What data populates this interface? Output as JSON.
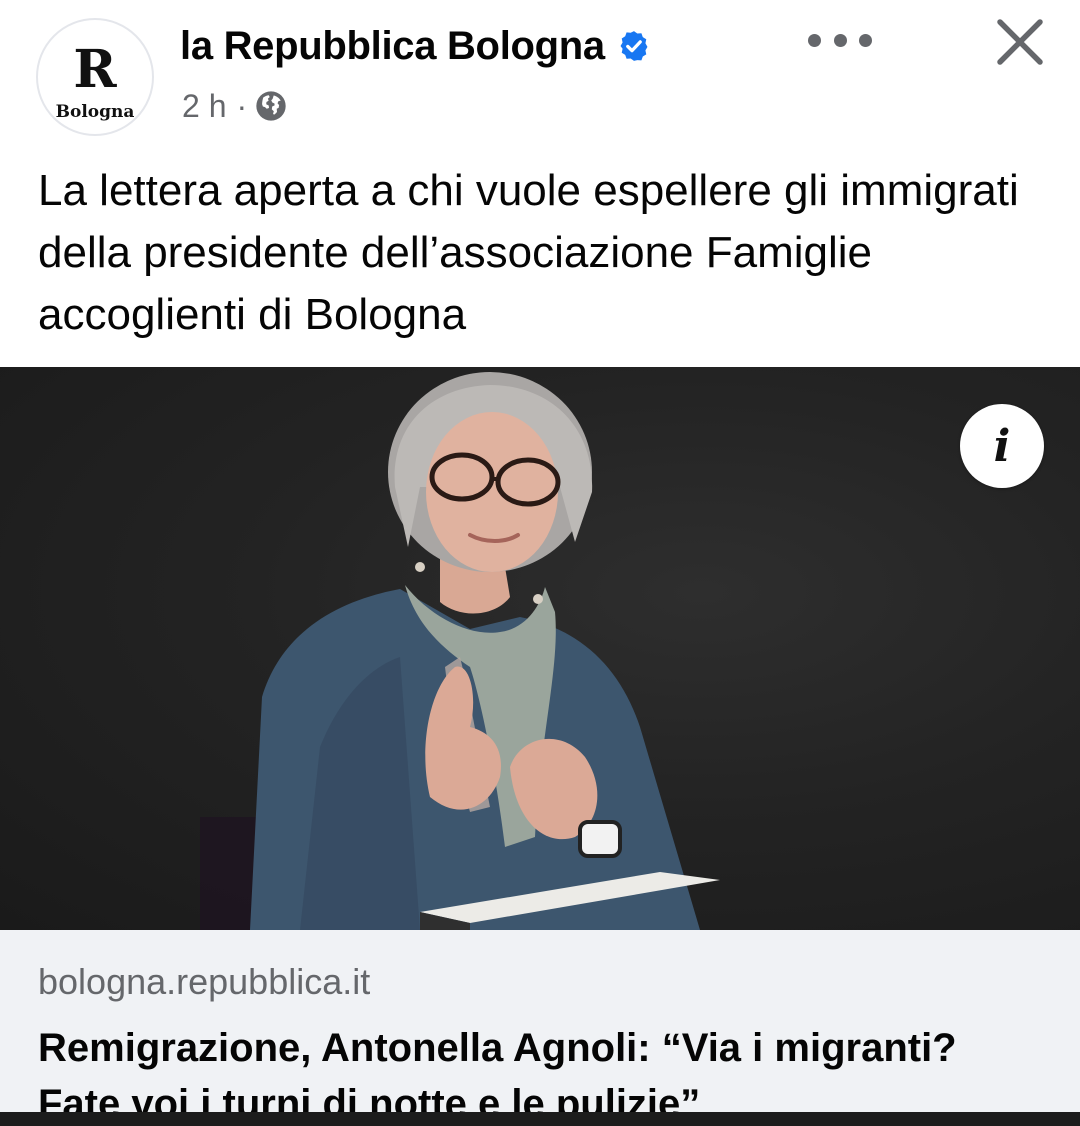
{
  "post": {
    "page_name": "la Repubblica Bologna",
    "avatar": {
      "letter": "R",
      "city": "Bologna"
    },
    "time": "2 h",
    "separator": "·",
    "verified": true,
    "icons": {
      "verified": "verified-badge-icon",
      "audience": "globe-icon",
      "more": "more-options-icon",
      "close": "close-icon",
      "info": "info-icon"
    },
    "text": "La lettera aperta a chi vuole espellere gli immigrati della presidente dell’associazione Famiglie accoglienti di Bologna",
    "info_label": "i",
    "link": {
      "domain": "bologna.repubblica.it",
      "title": "Remigrazione, Antonella Agnoli: “Via i migranti? Fate voi i turni di notte e le pulizie”"
    }
  },
  "colors": {
    "verified_blue": "#1877f2",
    "secondary_text": "#65676b",
    "link_background": "#f0f2f5",
    "image_background": "#222222"
  }
}
